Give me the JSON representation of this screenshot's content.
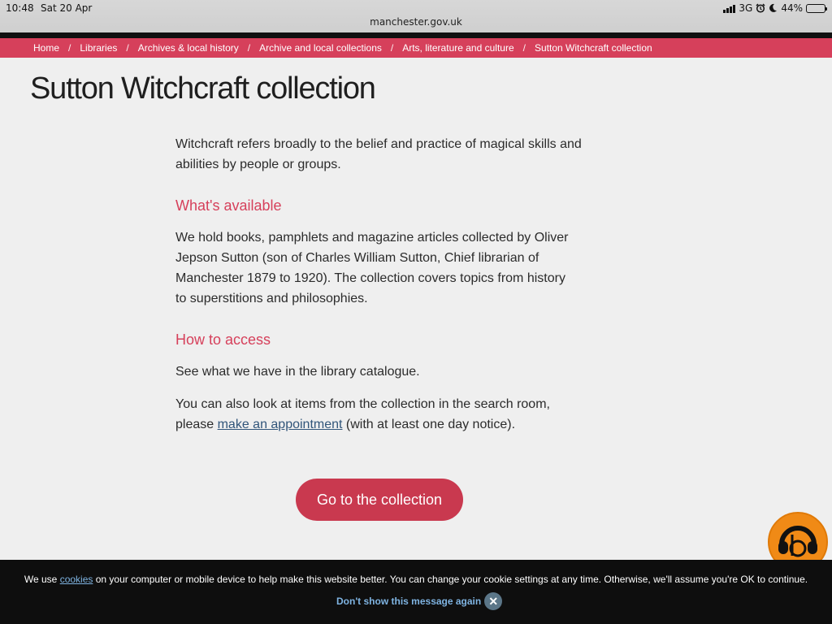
{
  "status_bar": {
    "time": "10:48",
    "date": "Sat 20 Apr",
    "url": "manchester.gov.uk",
    "network": "3G",
    "battery": "44%",
    "battery_level": 0.44
  },
  "breadcrumb": [
    {
      "label": "Home"
    },
    {
      "label": "Libraries"
    },
    {
      "label": "Archives & local history"
    },
    {
      "label": "Archive and local collections"
    },
    {
      "label": "Arts, literature and culture"
    },
    {
      "label": "Sutton Witchcraft collection"
    }
  ],
  "page": {
    "title": "Sutton Witchcraft collection",
    "intro_line1": "Witchcraft refers broadly to the belief and practice of magical skills and",
    "intro_line2": "abilities by people or groups.",
    "section1_heading": "What's available",
    "section1_lines": [
      "We hold books, pamphlets and magazine articles collected by Oliver",
      "Jepson Sutton (son of Charles William Sutton, Chief librarian of",
      "Manchester 1879 to 1920). The collection covers topics from history",
      "to superstitions and philosophies."
    ],
    "section2_heading": "How to access",
    "section2_p1": "See what we have in the library catalogue.",
    "section2_p2_line1": "You can also look at items from the collection in the search room,",
    "section2_p2_pre": "please ",
    "section2_p2_link": "make an appointment",
    "section2_p2_post": " (with at least one day notice).",
    "cta_label": "Go to the collection"
  },
  "cookie_banner": {
    "text_before": "We use ",
    "link": "cookies",
    "text_after": " on your computer or mobile device to help make this website better. You can change your cookie settings at any time. Otherwise, we'll assume you're OK to continue.",
    "dismiss_label": "Don't show this message again",
    "close_symbol": "✕"
  },
  "colors": {
    "brand": "#d6405b",
    "cta": "#c9394f",
    "widget": "#f08a16",
    "link": "#31557a"
  },
  "icons": {
    "widget": "headphones-b-icon",
    "close": "close-icon"
  }
}
